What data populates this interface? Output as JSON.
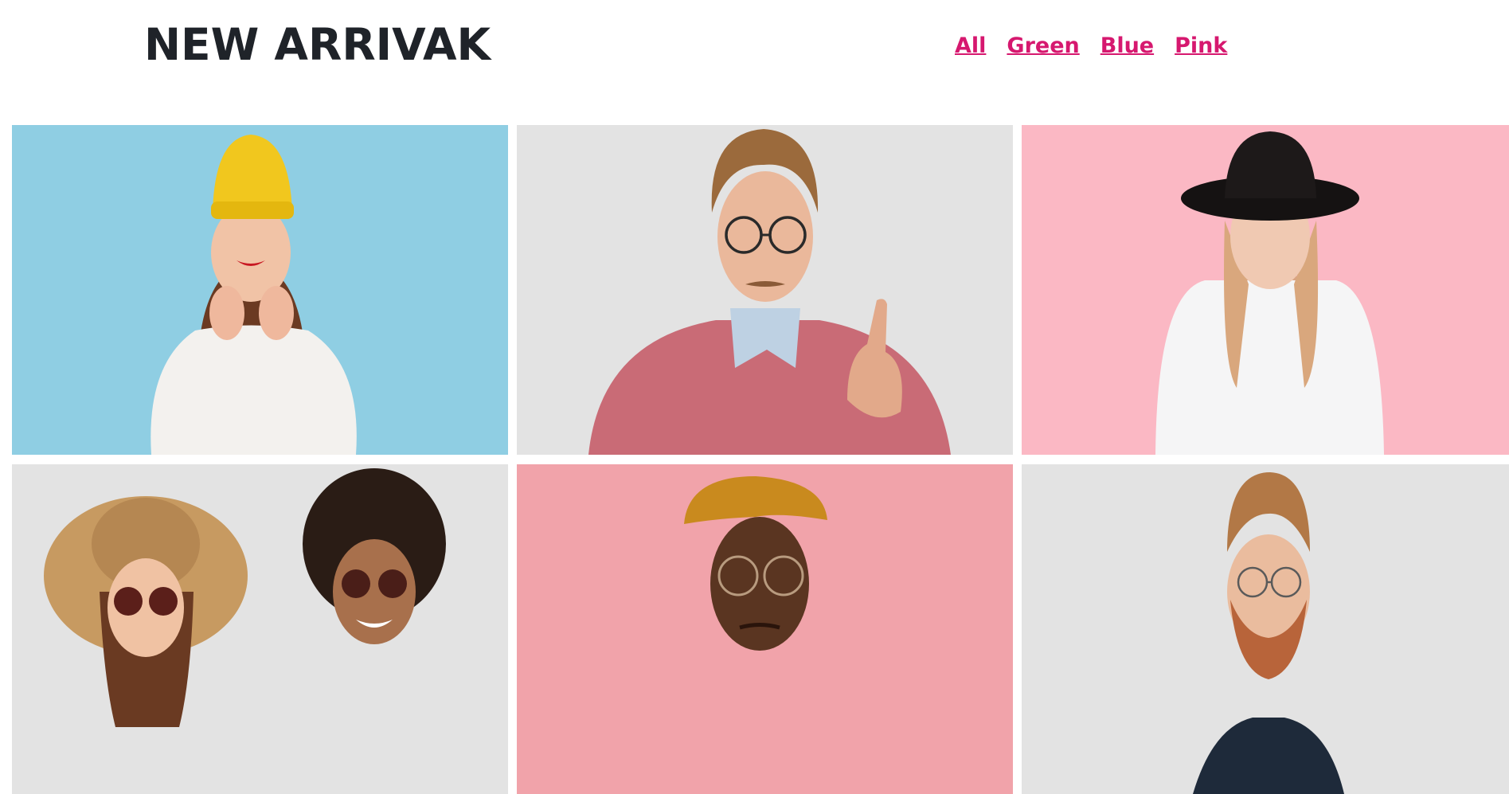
{
  "header": {
    "title": "NEW ARRIVAK",
    "filters": [
      "All",
      "Green",
      "Blue",
      "Pink"
    ]
  },
  "colors": {
    "title": "#1f2329",
    "filter_link": "#d6186f",
    "bg_blue": "#95d2e6",
    "bg_grey": "#e3e3e3",
    "bg_pink": "#fbb8c4",
    "bg_salmon": "#ee9ca3"
  },
  "gallery": [
    {
      "subject": "woman-yellow-beanie",
      "background": "blue"
    },
    {
      "subject": "man-glasses-pink-sweater",
      "background": "grey"
    },
    {
      "subject": "woman-black-hat",
      "background": "pink"
    },
    {
      "subject": "two-women-sunglasses",
      "background": "grey"
    },
    {
      "subject": "man-mustard-cap",
      "background": "pink"
    },
    {
      "subject": "bearded-man-glasses",
      "background": "grey"
    }
  ]
}
